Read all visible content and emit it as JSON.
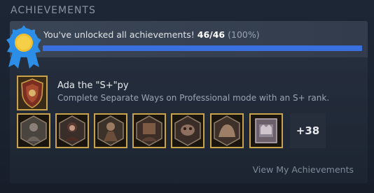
{
  "section_title": "ACHIEVEMENTS",
  "summary": {
    "text": "You've unlocked all achievements!",
    "count": "46/46",
    "percent": "(100%)",
    "progress_fraction": 1.0,
    "accent_color": "#3a70dd"
  },
  "featured": {
    "name": "Ada the \"S+\"py",
    "description": "Complete Separate Ways on Professional mode with an S+ rank.",
    "icon": "shield-medallion-icon"
  },
  "achievement_icons": [
    {
      "icon": "soldier-portrait-icon"
    },
    {
      "icon": "woman-portrait-icon"
    },
    {
      "icon": "villager-portrait-icon"
    },
    {
      "icon": "monster-portrait-icon"
    },
    {
      "icon": "creature-portrait-icon"
    },
    {
      "icon": "beast-portrait-icon"
    },
    {
      "icon": "crown-relic-icon"
    }
  ],
  "more_count": "+38",
  "view_link": "View My Achievements",
  "colors": {
    "gold_border": "#c9a34a",
    "badge_gold": "#f2c030",
    "badge_blue": "#2c8ee6"
  }
}
